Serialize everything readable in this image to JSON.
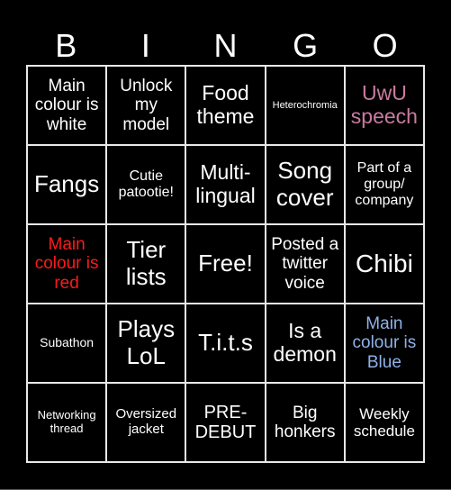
{
  "header": {
    "letters": [
      "B",
      "I",
      "N",
      "G",
      "O"
    ]
  },
  "colors": {
    "background": "#000000",
    "text_default": "#ffffff",
    "grid_lines": "#e8e8e8",
    "pink": "#c97ba0",
    "red": "#ff1a1a",
    "blue": "#8fb2e8"
  },
  "cells": [
    {
      "text": "Main colour is white",
      "color": "#ffffff"
    },
    {
      "text": "Unlock my model",
      "color": "#ffffff"
    },
    {
      "text": "Food theme",
      "color": "#ffffff"
    },
    {
      "text": "Heterochromia",
      "color": "#ffffff"
    },
    {
      "text": "UwU speech",
      "color": "#c97ba0"
    },
    {
      "text": "Fangs",
      "color": "#ffffff"
    },
    {
      "text": "Cutie patootie!",
      "color": "#ffffff"
    },
    {
      "text": "Multi-lingual",
      "color": "#ffffff"
    },
    {
      "text": "Song cover",
      "color": "#ffffff"
    },
    {
      "text": "Part of a group/ company",
      "color": "#ffffff"
    },
    {
      "text": "Main colour is red",
      "color": "#ff1a1a"
    },
    {
      "text": "Tier lists",
      "color": "#ffffff"
    },
    {
      "text": "Free!",
      "color": "#ffffff"
    },
    {
      "text": "Posted a twitter voice",
      "color": "#ffffff"
    },
    {
      "text": "Chibi",
      "color": "#ffffff"
    },
    {
      "text": "Subathon",
      "color": "#ffffff"
    },
    {
      "text": "Plays LoL",
      "color": "#ffffff"
    },
    {
      "text": "T.i.t.s",
      "color": "#ffffff"
    },
    {
      "text": "Is a demon",
      "color": "#ffffff"
    },
    {
      "text": "Main colour is Blue",
      "color": "#8fb2e8"
    },
    {
      "text": "Networking thread",
      "color": "#ffffff"
    },
    {
      "text": "Oversized jacket",
      "color": "#ffffff"
    },
    {
      "text": "PRE-DEBUT",
      "color": "#ffffff"
    },
    {
      "text": "Big honkers",
      "color": "#ffffff"
    },
    {
      "text": "Weekly schedule",
      "color": "#ffffff"
    }
  ]
}
